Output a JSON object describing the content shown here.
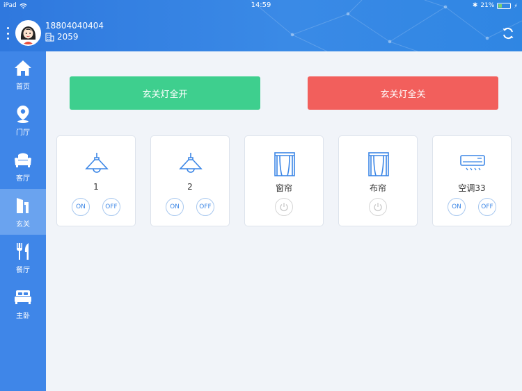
{
  "status_bar": {
    "device": "iPad",
    "time": "14:59",
    "battery": "21%"
  },
  "user": {
    "phone": "18804040404",
    "room": "2059"
  },
  "sidebar": {
    "items": [
      {
        "label": "首页",
        "icon": "home-icon"
      },
      {
        "label": "门厅",
        "icon": "location-pin-icon"
      },
      {
        "label": "客厅",
        "icon": "sofa-icon"
      },
      {
        "label": "玄关",
        "icon": "entrance-icon",
        "active": true
      },
      {
        "label": "餐厅",
        "icon": "fork-knife-icon"
      },
      {
        "label": "主卧",
        "icon": "bed-icon"
      }
    ]
  },
  "actions": {
    "all_on": "玄关灯全开",
    "all_off": "玄关灯全关"
  },
  "devices": [
    {
      "name": "1",
      "icon": "lamp-icon",
      "on": "ON",
      "off": "OFF"
    },
    {
      "name": "2",
      "icon": "lamp-icon",
      "on": "ON",
      "off": "OFF"
    },
    {
      "name": "窗帘",
      "icon": "curtain-icon"
    },
    {
      "name": "布帘",
      "icon": "curtain-icon"
    },
    {
      "name": "空调33",
      "icon": "air-conditioner-icon",
      "on": "ON",
      "off": "OFF"
    }
  ],
  "colors": {
    "header": "#2f78de",
    "sidebar": "#3f86e8",
    "on_button": "#3ecf8e",
    "off_button": "#f25f5c",
    "icon_blue": "#3b86e6"
  }
}
